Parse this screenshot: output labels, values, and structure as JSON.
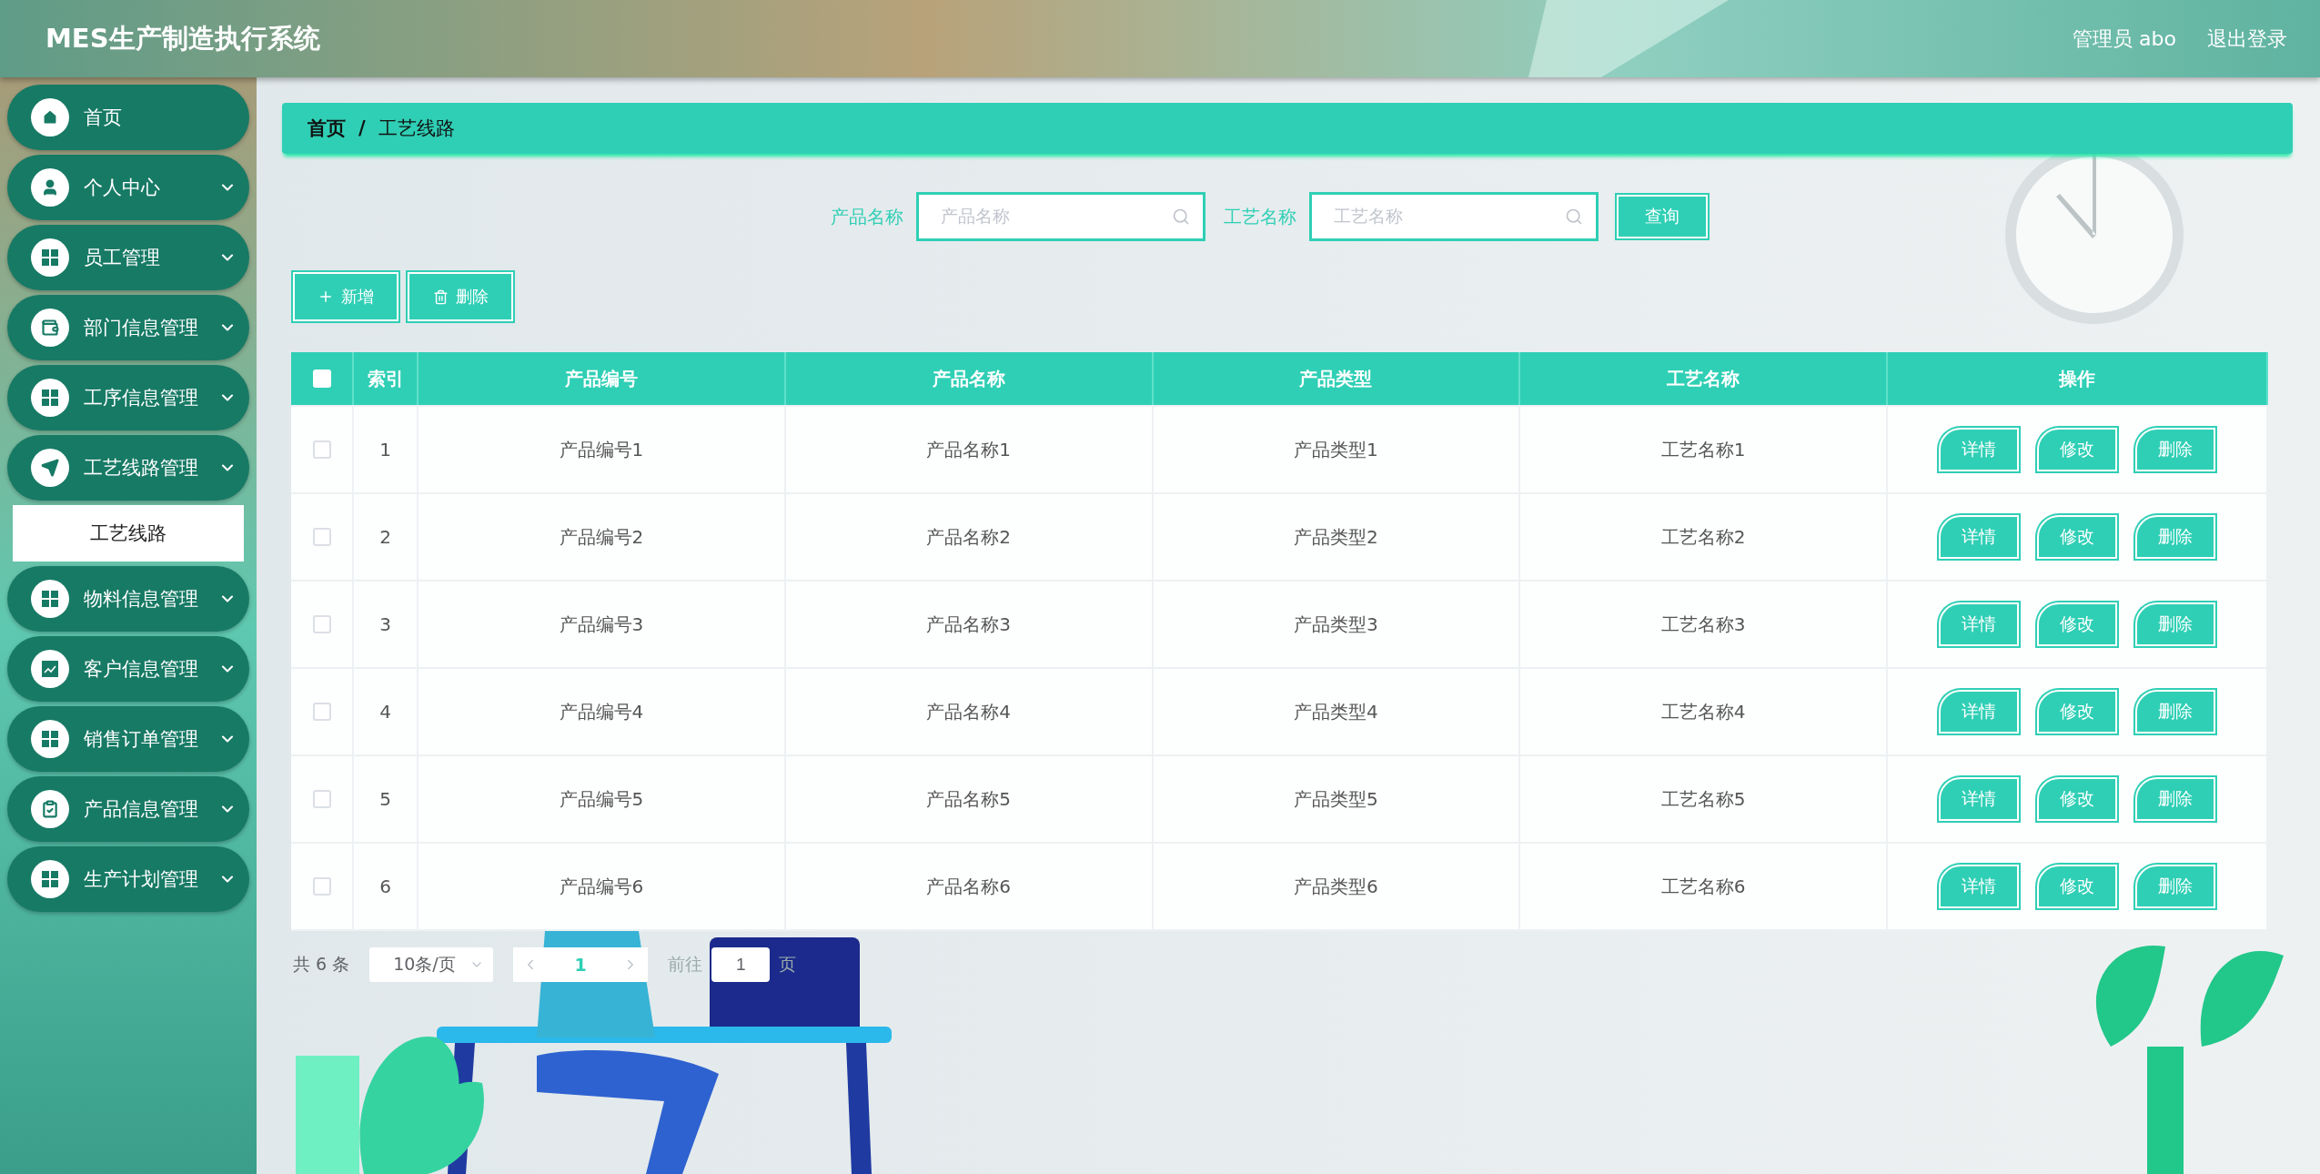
{
  "header": {
    "title": "MES生产制造执行系统",
    "user": "管理员 abo",
    "logout": "退出登录"
  },
  "sidebar": {
    "items": [
      {
        "label": "首页",
        "kind": "home",
        "submenu": false
      },
      {
        "label": "个人中心",
        "kind": "user",
        "submenu": true
      },
      {
        "label": "员工管理",
        "kind": "grid",
        "submenu": true
      },
      {
        "label": "部门信息管理",
        "kind": "wallet",
        "submenu": true
      },
      {
        "label": "工序信息管理",
        "kind": "grid",
        "submenu": true
      },
      {
        "label": "工艺线路管理",
        "kind": "send",
        "submenu": true,
        "children": [
          {
            "label": "工艺线路",
            "selected": true
          }
        ]
      },
      {
        "label": "物料信息管理",
        "kind": "grid",
        "submenu": true
      },
      {
        "label": "客户信息管理",
        "kind": "chart",
        "submenu": true
      },
      {
        "label": "销售订单管理",
        "kind": "grid",
        "submenu": true
      },
      {
        "label": "产品信息管理",
        "kind": "clipboard",
        "submenu": true
      },
      {
        "label": "生产计划管理",
        "kind": "grid",
        "submenu": true
      }
    ]
  },
  "breadcrumb": {
    "items": [
      "首页",
      "工艺线路"
    ],
    "separator": "/"
  },
  "search": {
    "fields": [
      {
        "label": "产品名称",
        "placeholder": "产品名称"
      },
      {
        "label": "工艺名称",
        "placeholder": "工艺名称"
      }
    ],
    "button": "查询"
  },
  "toolbar": {
    "buttons": [
      {
        "label": "新增",
        "kind": "add"
      },
      {
        "label": "删除",
        "kind": "delete"
      }
    ]
  },
  "table": {
    "select_all": {
      "checked": false
    },
    "columns": [
      "索引",
      "产品编号",
      "产品名称",
      "产品类型",
      "工艺名称",
      "操作"
    ],
    "rows": [
      {
        "checked": false,
        "cells": [
          "1",
          "产品编号1",
          "产品名称1",
          "产品类型1",
          "工艺名称1"
        ],
        "actions": [
          "详情",
          "修改",
          "删除"
        ]
      },
      {
        "checked": false,
        "cells": [
          "2",
          "产品编号2",
          "产品名称2",
          "产品类型2",
          "工艺名称2"
        ],
        "actions": [
          "详情",
          "修改",
          "删除"
        ]
      },
      {
        "checked": false,
        "cells": [
          "3",
          "产品编号3",
          "产品名称3",
          "产品类型3",
          "工艺名称3"
        ],
        "actions": [
          "详情",
          "修改",
          "删除"
        ]
      },
      {
        "checked": false,
        "cells": [
          "4",
          "产品编号4",
          "产品名称4",
          "产品类型4",
          "工艺名称4"
        ],
        "actions": [
          "详情",
          "修改",
          "删除"
        ]
      },
      {
        "checked": false,
        "cells": [
          "5",
          "产品编号5",
          "产品名称5",
          "产品类型5",
          "工艺名称5"
        ],
        "actions": [
          "详情",
          "修改",
          "删除"
        ]
      },
      {
        "checked": false,
        "cells": [
          "6",
          "产品编号6",
          "产品名称6",
          "产品类型6",
          "工艺名称6"
        ],
        "actions": [
          "详情",
          "修改",
          "删除"
        ]
      }
    ]
  },
  "pagination": {
    "total": "共 6 条",
    "page_size": "10条/页",
    "current": "1",
    "goto_label": "前往",
    "goto_value": "1",
    "goto_unit": "页"
  }
}
